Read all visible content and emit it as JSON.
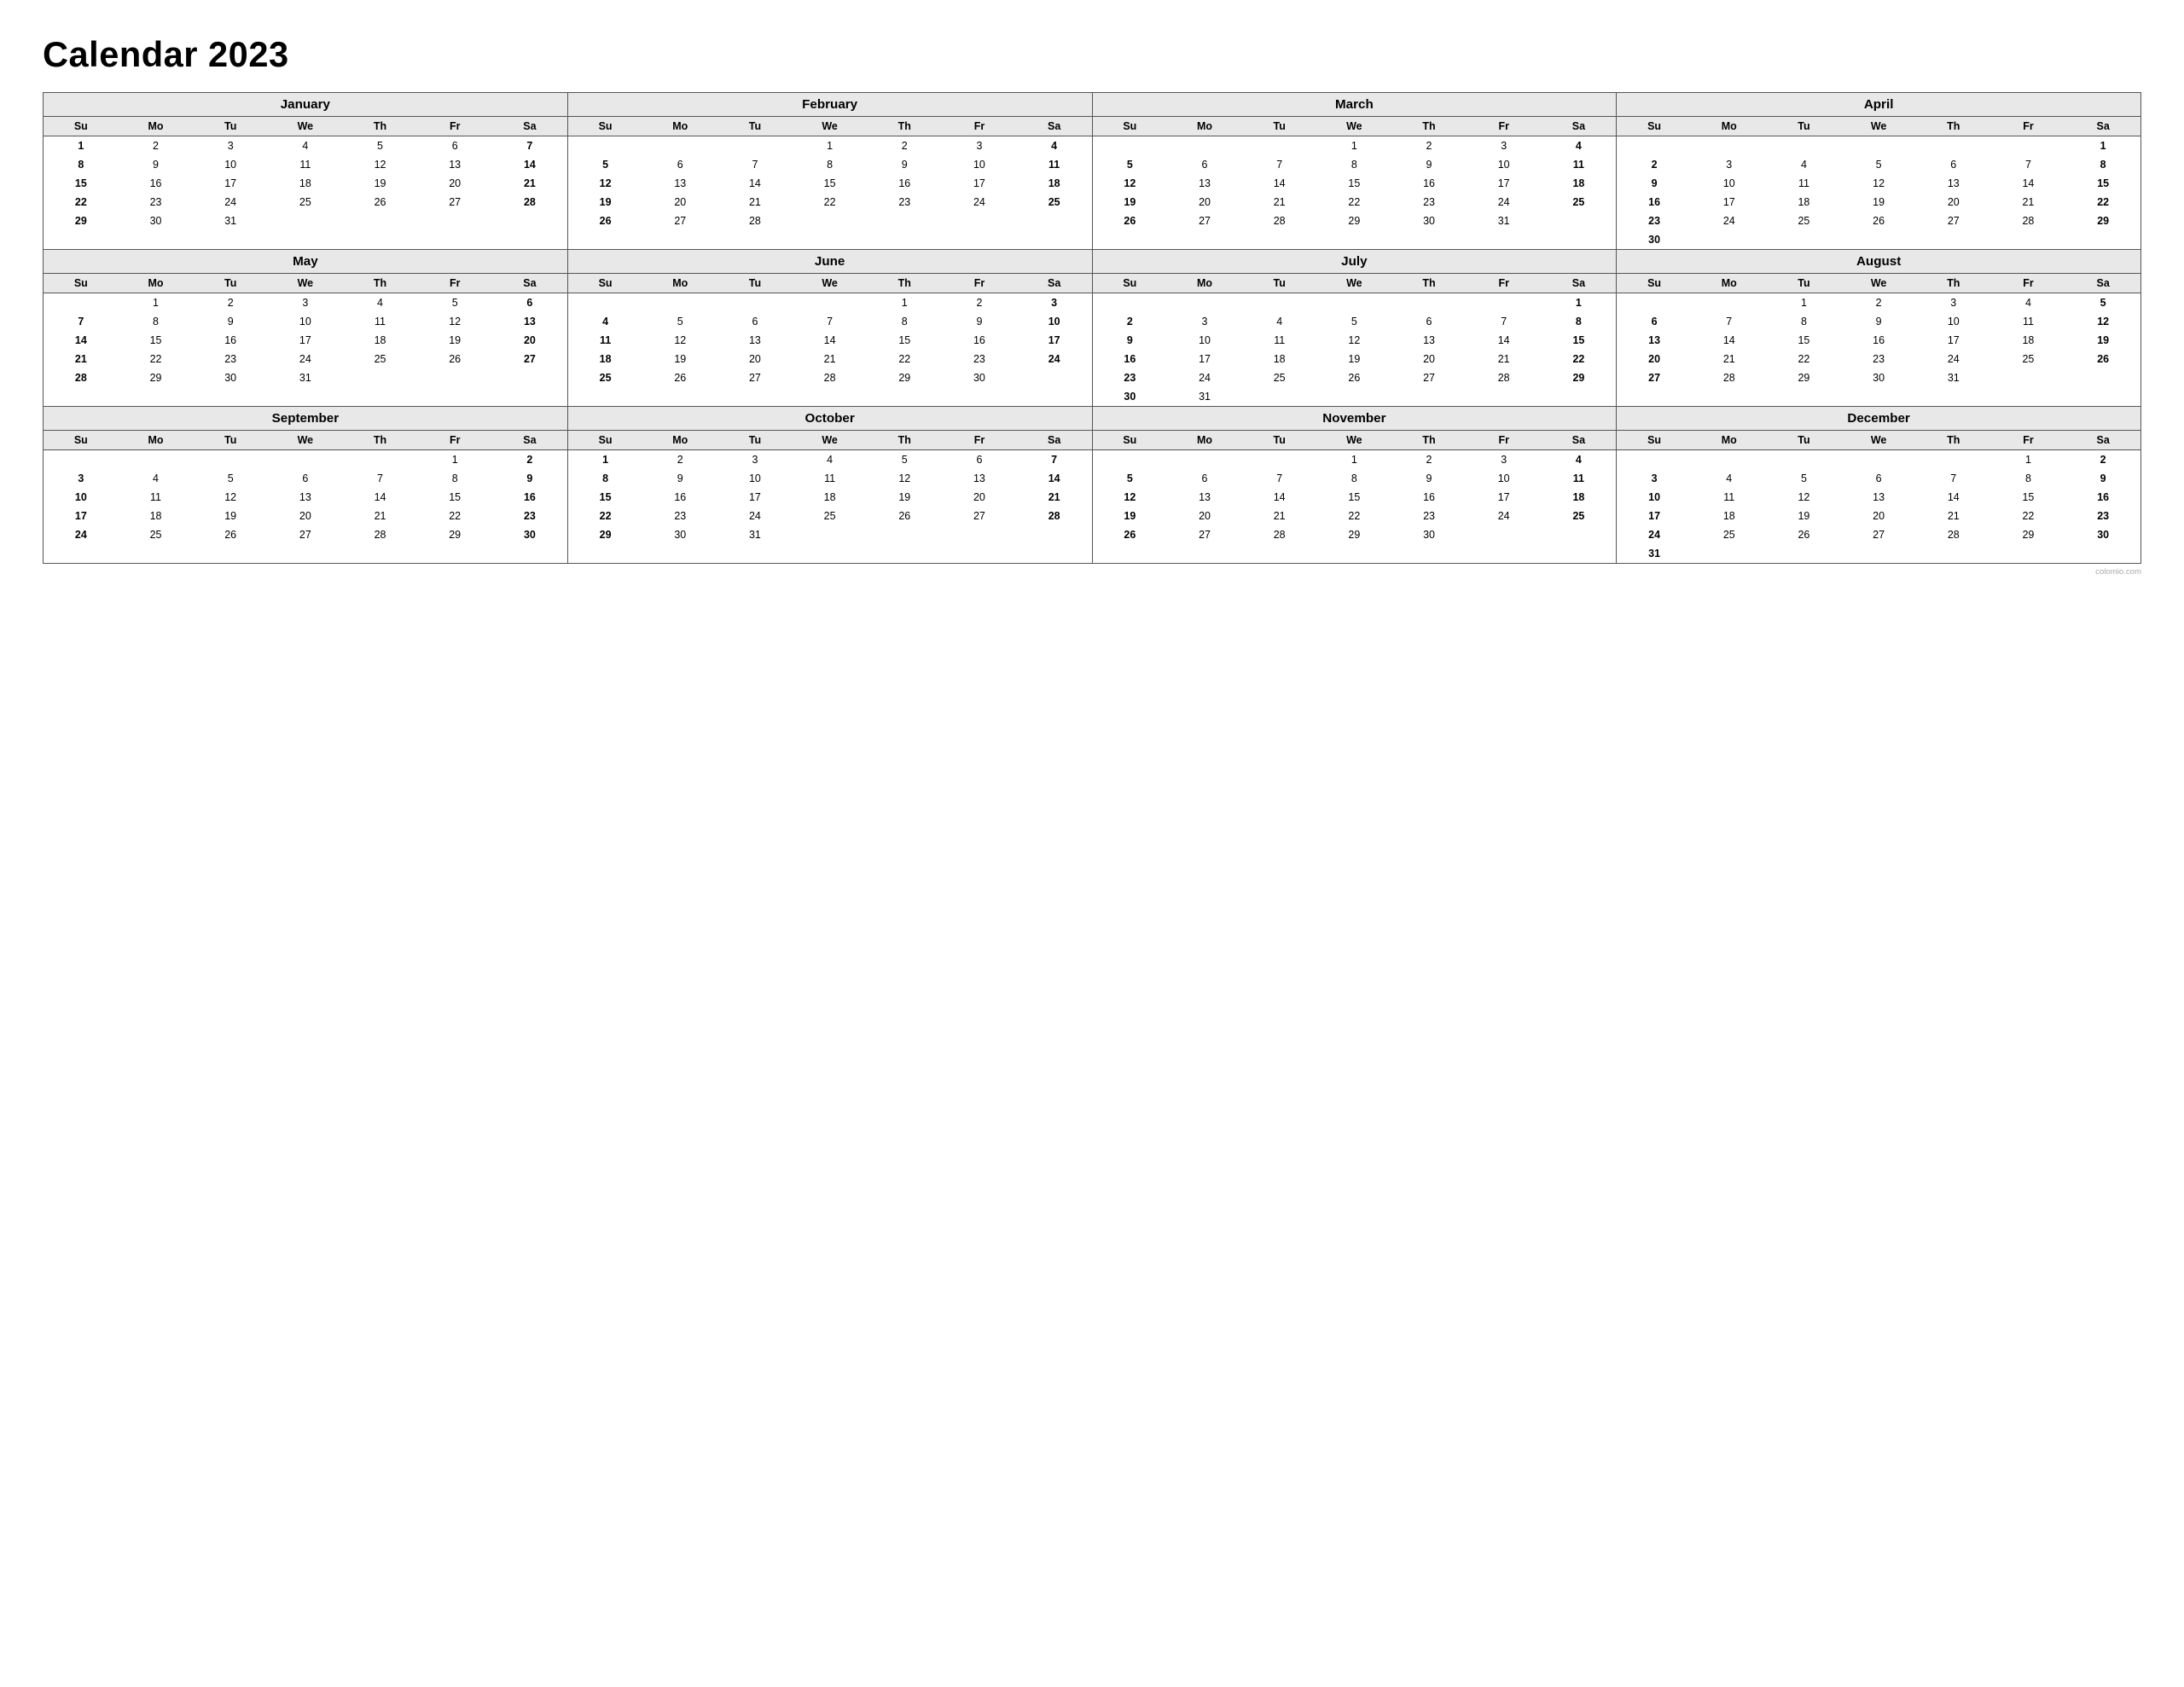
{
  "title": "Calendar 2023",
  "watermark": "colomio.com",
  "months": [
    {
      "name": "January",
      "weeks": [
        [
          "",
          "",
          "",
          "",
          "",
          "",
          "7"
        ],
        [
          "1",
          "2",
          "3",
          "4",
          "5",
          "6",
          "7"
        ],
        [
          "8",
          "9",
          "10",
          "11",
          "12",
          "13",
          "14"
        ],
        [
          "15",
          "16",
          "17",
          "18",
          "19",
          "20",
          "21"
        ],
        [
          "22",
          "23",
          "24",
          "25",
          "26",
          "27",
          "28"
        ],
        [
          "29",
          "30",
          "31",
          "",
          "",
          "",
          ""
        ]
      ],
      "startDay": 0,
      "days": [
        1,
        2,
        3,
        4,
        5,
        6,
        7,
        8,
        9,
        10,
        11,
        12,
        13,
        14,
        15,
        16,
        17,
        18,
        19,
        20,
        21,
        22,
        23,
        24,
        25,
        26,
        27,
        28,
        29,
        30,
        31
      ],
      "firstDayOfWeek": 0
    },
    {
      "name": "February",
      "firstDayOfWeek": 3,
      "days": [
        1,
        2,
        3,
        4,
        5,
        6,
        7,
        8,
        9,
        10,
        11,
        12,
        13,
        14,
        15,
        16,
        17,
        18,
        19,
        20,
        21,
        22,
        23,
        24,
        25,
        26,
        27,
        28
      ]
    },
    {
      "name": "March",
      "firstDayOfWeek": 3,
      "days": [
        1,
        2,
        3,
        4,
        5,
        6,
        7,
        8,
        9,
        10,
        11,
        12,
        13,
        14,
        15,
        16,
        17,
        18,
        19,
        20,
        21,
        22,
        23,
        24,
        25,
        26,
        27,
        28,
        29,
        30,
        31
      ]
    },
    {
      "name": "April",
      "firstDayOfWeek": 6,
      "days": [
        1,
        2,
        3,
        4,
        5,
        6,
        7,
        8,
        9,
        10,
        11,
        12,
        13,
        14,
        15,
        16,
        17,
        18,
        19,
        20,
        21,
        22,
        23,
        24,
        25,
        26,
        27,
        28,
        29,
        30
      ]
    },
    {
      "name": "May",
      "firstDayOfWeek": 1,
      "days": [
        1,
        2,
        3,
        4,
        5,
        6,
        7,
        8,
        9,
        10,
        11,
        12,
        13,
        14,
        15,
        16,
        17,
        18,
        19,
        20,
        21,
        22,
        23,
        24,
        25,
        26,
        27,
        28,
        29,
        30,
        31
      ]
    },
    {
      "name": "June",
      "firstDayOfWeek": 4,
      "days": [
        1,
        2,
        3,
        4,
        5,
        6,
        7,
        8,
        9,
        10,
        11,
        12,
        13,
        14,
        15,
        16,
        17,
        18,
        19,
        20,
        21,
        22,
        23,
        24,
        25,
        26,
        27,
        28,
        29,
        30
      ]
    },
    {
      "name": "July",
      "firstDayOfWeek": 6,
      "days": [
        1,
        2,
        3,
        4,
        5,
        6,
        7,
        8,
        9,
        10,
        11,
        12,
        13,
        14,
        15,
        16,
        17,
        18,
        19,
        20,
        21,
        22,
        23,
        24,
        25,
        26,
        27,
        28,
        29,
        30,
        31
      ]
    },
    {
      "name": "August",
      "firstDayOfWeek": 2,
      "days": [
        1,
        2,
        3,
        4,
        5,
        6,
        7,
        8,
        9,
        10,
        11,
        12,
        13,
        14,
        15,
        16,
        17,
        18,
        19,
        20,
        21,
        22,
        23,
        24,
        25,
        26,
        27,
        28,
        29,
        30,
        31
      ]
    },
    {
      "name": "September",
      "firstDayOfWeek": 5,
      "days": [
        1,
        2,
        3,
        4,
        5,
        6,
        7,
        8,
        9,
        10,
        11,
        12,
        13,
        14,
        15,
        16,
        17,
        18,
        19,
        20,
        21,
        22,
        23,
        24,
        25,
        26,
        27,
        28,
        29,
        30
      ]
    },
    {
      "name": "October",
      "firstDayOfWeek": 0,
      "days": [
        1,
        2,
        3,
        4,
        5,
        6,
        7,
        8,
        9,
        10,
        11,
        12,
        13,
        14,
        15,
        16,
        17,
        18,
        19,
        20,
        21,
        22,
        23,
        24,
        25,
        26,
        27,
        28,
        29,
        30,
        31
      ]
    },
    {
      "name": "November",
      "firstDayOfWeek": 3,
      "days": [
        1,
        2,
        3,
        4,
        5,
        6,
        7,
        8,
        9,
        10,
        11,
        12,
        13,
        14,
        15,
        16,
        17,
        18,
        19,
        20,
        21,
        22,
        23,
        24,
        25,
        26,
        27,
        28,
        29,
        30
      ]
    },
    {
      "name": "December",
      "firstDayOfWeek": 5,
      "days": [
        1,
        2,
        3,
        4,
        5,
        6,
        7,
        8,
        9,
        10,
        11,
        12,
        13,
        14,
        15,
        16,
        17,
        18,
        19,
        20,
        21,
        22,
        23,
        24,
        25,
        26,
        27,
        28,
        29,
        30,
        31
      ]
    }
  ],
  "dayHeaders": [
    "Su",
    "Mo",
    "Tu",
    "We",
    "Th",
    "Fr",
    "Sa"
  ]
}
